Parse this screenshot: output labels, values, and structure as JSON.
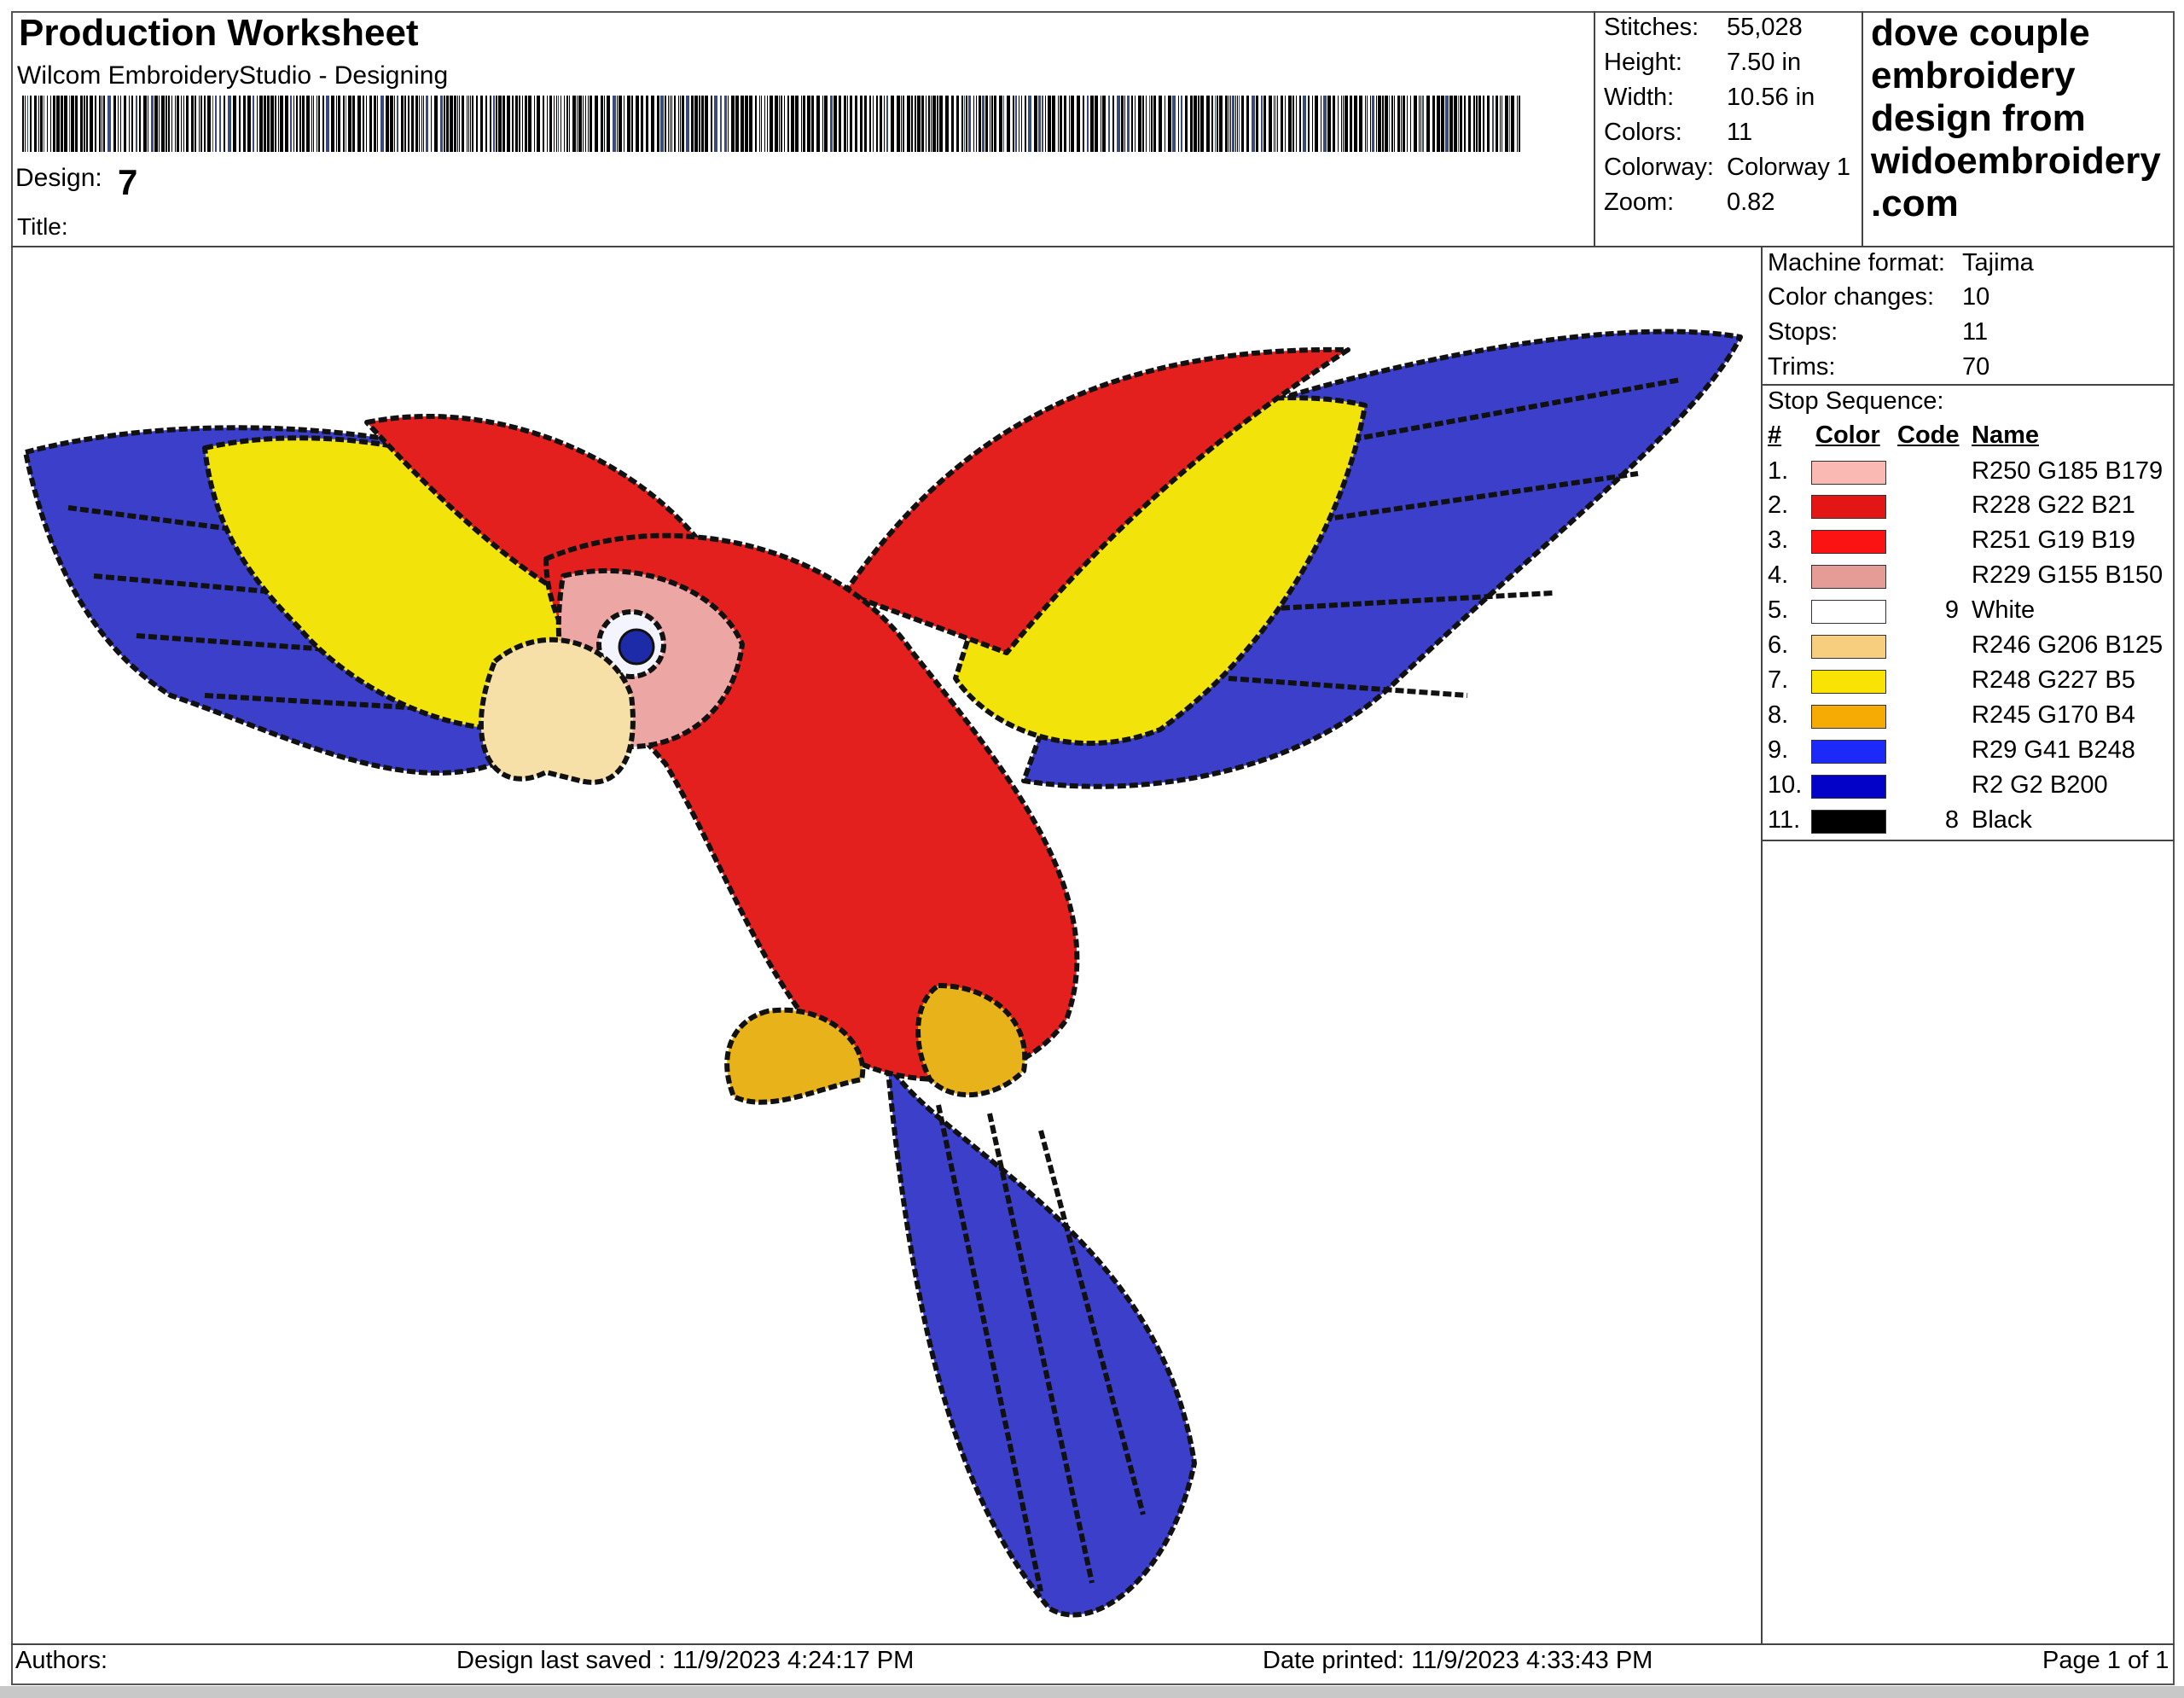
{
  "header": {
    "title": "Production Worksheet",
    "subtitle": "Wilcom EmbroideryStudio - Designing",
    "design_label": "Design:",
    "design_value": "7",
    "title_label": "Title:"
  },
  "stats": [
    {
      "label": "Stitches:",
      "value": "55,028"
    },
    {
      "label": "Height:",
      "value": "7.50 in"
    },
    {
      "label": "Width:",
      "value": "10.56 in"
    },
    {
      "label": "Colors:",
      "value": "11"
    },
    {
      "label": "Colorway:",
      "value": "Colorway 1"
    },
    {
      "label": "Zoom:",
      "value": "0.82"
    }
  ],
  "brand": {
    "lines": [
      "dove couple",
      "embroidery",
      "design from",
      "widoembroidery",
      ".com"
    ]
  },
  "machine": [
    {
      "label": "Machine format:",
      "value": "Tajima"
    },
    {
      "label": "Color changes:",
      "value": "10"
    },
    {
      "label": "Stops:",
      "value": "11"
    },
    {
      "label": "Trims:",
      "value": "70"
    }
  ],
  "stop_sequence": {
    "title": "Stop Sequence:",
    "headers": {
      "num": "#",
      "color": "Color",
      "code": "Code",
      "name": "Name"
    },
    "rows": [
      {
        "num": "1.",
        "color": "#FAB9B3",
        "code": "",
        "name": "R250 G185 B179"
      },
      {
        "num": "2.",
        "color": "#E41615",
        "code": "",
        "name": "R228 G22 B21"
      },
      {
        "num": "3.",
        "color": "#FB1313",
        "code": "",
        "name": "R251 G19 B19"
      },
      {
        "num": "4.",
        "color": "#E59B96",
        "code": "",
        "name": "R229 G155 B150"
      },
      {
        "num": "5.",
        "color": "#FFFFFF",
        "code": "9",
        "name": "White"
      },
      {
        "num": "6.",
        "color": "#F6CE7D",
        "code": "",
        "name": "R246 G206 B125"
      },
      {
        "num": "7.",
        "color": "#F8E305",
        "code": "",
        "name": "R248 G227 B5"
      },
      {
        "num": "8.",
        "color": "#F5AA04",
        "code": "",
        "name": "R245 G170 B4"
      },
      {
        "num": "9.",
        "color": "#1D29F8",
        "code": "",
        "name": "R29 G41 B248"
      },
      {
        "num": "10.",
        "color": "#0202C8",
        "code": "",
        "name": "R2 G2 B200"
      },
      {
        "num": "11.",
        "color": "#000000",
        "code": "8",
        "name": "Black"
      }
    ]
  },
  "footer": {
    "authors": "Authors:",
    "saved": "Design last saved : 11/9/2023 4:24:17 PM",
    "printed": "Date printed: 11/9/2023 4:33:43 PM",
    "page": "Page 1 of 1"
  }
}
